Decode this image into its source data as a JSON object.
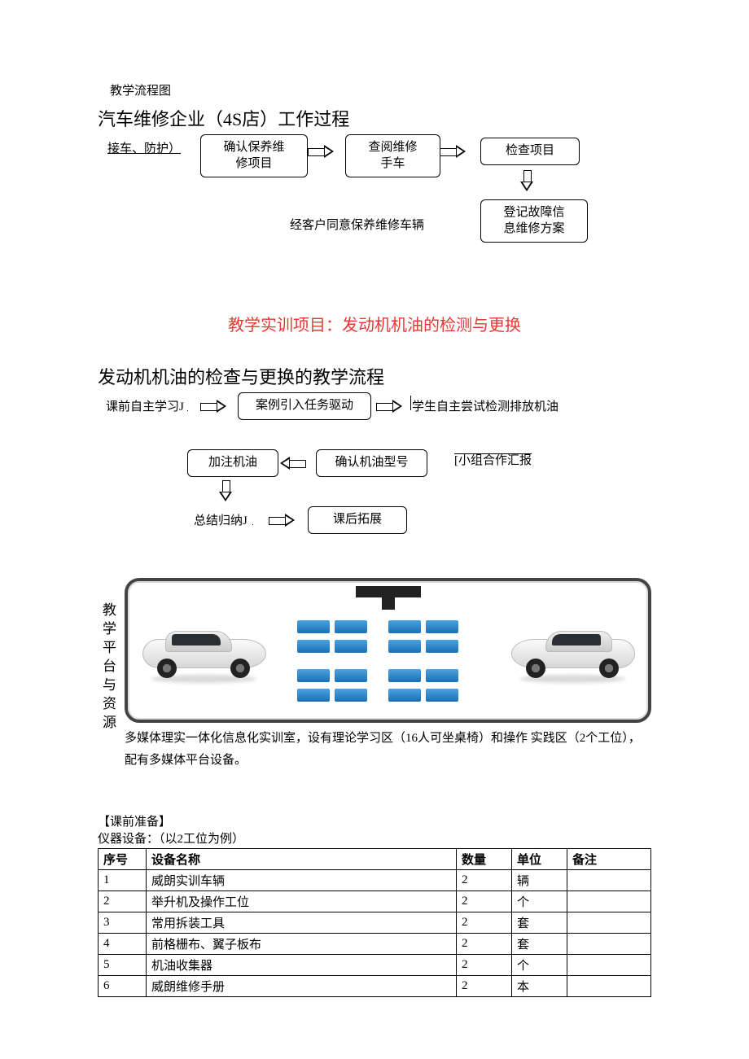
{
  "top_label": "教学流程图",
  "section1": {
    "title": "汽车维修企业（4S店）工作过程",
    "start": "接车、防护）",
    "b1": "确认保养维\n修项目",
    "b2": "查阅维修\n手车",
    "b3": "检查项目",
    "b4": "登记故障信\n息维修方案",
    "note": "经客户同意保养维修车辆"
  },
  "red_title": "教学实训项目：发动机机油的检测与更换",
  "section2": {
    "title": "发动机机油的检查与更换的教学流程",
    "pre": "课前自主学习J",
    "b1": "案例引入任务驱动",
    "post_right": "学生自主尝试检测排放机油",
    "b2r": "确认机油型号",
    "b2l": "加注机油",
    "right_label": "[小组合作汇报",
    "b3label": "总结归纳J",
    "b3": "课后拓展"
  },
  "classroom": {
    "label": "教学平台与资源",
    "caption": "多媒体理实一体化信息化实训室，设有理论学习区（16人可坐桌椅）和操作  实践区（2个工位），配有多媒体平台设备。"
  },
  "prep": {
    "header": "【课前准备】",
    "sub": "仪器设备：（以2工位为例）",
    "cols": {
      "no": "序号",
      "name": "设备名称",
      "qty": "数量",
      "unit": "单位",
      "remark": "备注"
    },
    "rows": [
      {
        "no": "1",
        "name": "威朗实训车辆",
        "qty": "2",
        "unit": "辆",
        "remark": ""
      },
      {
        "no": "2",
        "name": "举升机及操作工位",
        "qty": "2",
        "unit": "个",
        "remark": ""
      },
      {
        "no": "3",
        "name": "常用拆装工具",
        "qty": "2",
        "unit": "套",
        "remark": ""
      },
      {
        "no": "4",
        "name": "前格栅布、翼子板布",
        "qty": "2",
        "unit": "套",
        "remark": ""
      },
      {
        "no": "5",
        "name": "机油收集器",
        "qty": "2",
        "unit": "个",
        "remark": ""
      },
      {
        "no": "6",
        "name": "威朗维修手册",
        "qty": "2",
        "unit": "本",
        "remark": ""
      }
    ]
  }
}
